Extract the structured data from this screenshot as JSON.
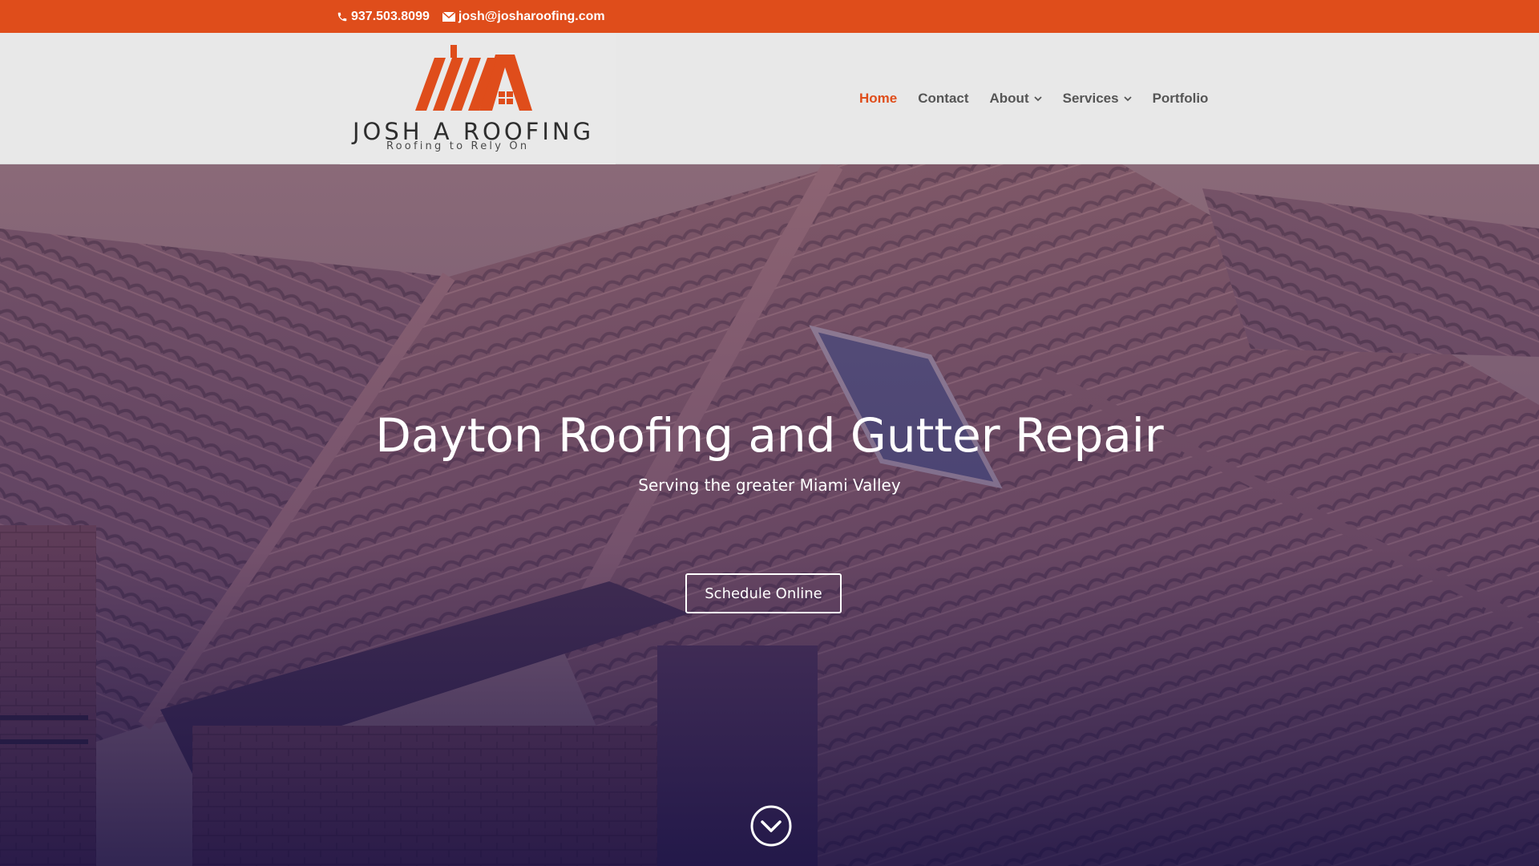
{
  "topbar": {
    "phone": "937.503.8099",
    "email": "josh@josharoofing.com",
    "phone_icon": "phone-icon",
    "email_icon": "envelope-icon"
  },
  "logo": {
    "name": "JOSH A ROOFING",
    "tagline": "Roofing to Rely On"
  },
  "nav": {
    "items": [
      {
        "label": "Home",
        "active": true
      },
      {
        "label": "Contact",
        "active": false
      },
      {
        "label": "About",
        "active": false,
        "dropdown": true
      },
      {
        "label": "Services",
        "active": false,
        "dropdown": true
      },
      {
        "label": "Portfolio",
        "active": false
      }
    ]
  },
  "hero": {
    "title": "Dayton Roofing and Gutter Repair",
    "subtitle": "Serving the greater Miami Valley",
    "button_label": "Schedule Online",
    "scroll_icon": "chevron-down-circle-icon"
  },
  "colors": {
    "accent": "#df4d1b",
    "header_bg": "#e8e8e8",
    "nav_text": "#555555"
  }
}
